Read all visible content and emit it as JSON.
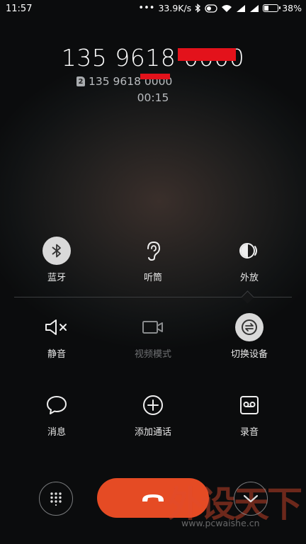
{
  "status_bar": {
    "time": "11:57",
    "net_speed": "33.9K/s",
    "battery": "38%",
    "battery_level": 0.38
  },
  "call": {
    "number": "135 9618 0000",
    "sim_badge": "2",
    "sub_number": "135 9618 0000",
    "duration": "00:15",
    "redaction_color": "#e3121b"
  },
  "controls": {
    "bluetooth": "蓝牙",
    "earpiece": "听筒",
    "speaker": "外放",
    "mute": "静音",
    "video": "视频模式",
    "switch_device": "切换设备",
    "message": "消息",
    "add_call": "添加通话",
    "record": "录音"
  },
  "end_call_color": "#e54b24",
  "watermark": {
    "title": "外设天下",
    "url": "www.pcwaishe.cn"
  }
}
